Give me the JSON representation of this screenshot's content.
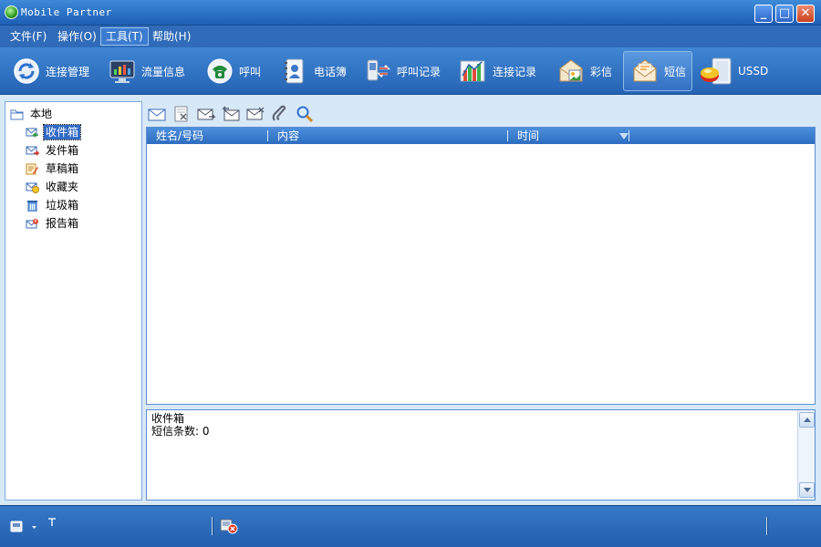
{
  "window": {
    "title": "Mobile Partner",
    "minimize_label": "_",
    "maximize_label": "□",
    "close_label": "✕"
  },
  "menu": [
    {
      "label": "文件(F)",
      "active": false
    },
    {
      "label": "操作(O)",
      "active": false
    },
    {
      "label": "工具(T)",
      "active": true
    },
    {
      "label": "帮助(H)",
      "active": false
    }
  ],
  "toolbar": [
    {
      "label": "连接管理",
      "icon": "connect-manage-icon",
      "selected": false
    },
    {
      "label": "流量信息",
      "icon": "traffic-monitor-icon",
      "selected": false
    },
    {
      "label": "呼叫",
      "icon": "phone-call-icon",
      "selected": false
    },
    {
      "label": "电话簿",
      "icon": "phonebook-icon",
      "selected": false
    },
    {
      "label": "呼叫记录",
      "icon": "call-log-icon",
      "selected": false
    },
    {
      "label": "连接记录",
      "icon": "connection-log-chart-icon",
      "selected": false
    },
    {
      "label": "彩信",
      "icon": "mms-icon",
      "selected": false
    },
    {
      "label": "短信",
      "icon": "sms-envelope-icon",
      "selected": true
    },
    {
      "label": "USSD",
      "icon": "ussd-icon",
      "selected": false
    }
  ],
  "tree": {
    "root": "本地",
    "items": [
      {
        "label": "收件箱",
        "icon": "inbox-icon",
        "selected": true
      },
      {
        "label": "发件箱",
        "icon": "outbox-icon",
        "selected": false
      },
      {
        "label": "草稿箱",
        "icon": "drafts-icon",
        "selected": false
      },
      {
        "label": "收藏夹",
        "icon": "favorites-icon",
        "selected": false
      },
      {
        "label": "垃圾箱",
        "icon": "trash-icon",
        "selected": false
      },
      {
        "label": "报告箱",
        "icon": "report-box-icon",
        "selected": false
      }
    ]
  },
  "message_toolbar": [
    {
      "icon": "new-message-icon"
    },
    {
      "icon": "delete-message-icon"
    },
    {
      "icon": "forward-message-icon"
    },
    {
      "icon": "reply-message-icon"
    },
    {
      "icon": "move-message-icon"
    },
    {
      "icon": "call-sender-icon"
    },
    {
      "icon": "search-icon"
    }
  ],
  "table": {
    "columns": [
      "姓名/号码",
      "内容",
      "时间"
    ],
    "rows": []
  },
  "info": {
    "folder": "收件箱",
    "count_line": "短信条数: 0"
  },
  "statusbar": {
    "left_icon": "network-device-icon",
    "middle_icon": "disconnected-icon"
  },
  "colors": {
    "chrome_blue": "#2b6cb8",
    "panel_bg": "#d7e8f7",
    "selection": "#316ac5"
  }
}
